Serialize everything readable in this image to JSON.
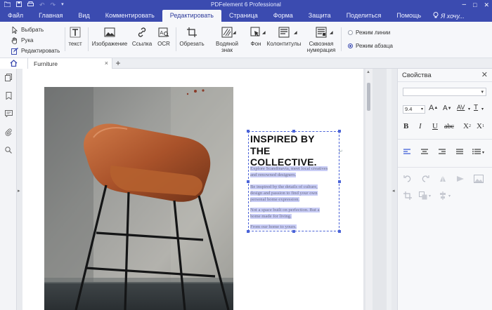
{
  "app": {
    "title": "PDFelement 6 Professional"
  },
  "window_controls": {
    "min": "–",
    "max": "□",
    "close": "✕"
  },
  "menu": {
    "items": [
      {
        "label": "Файл",
        "active": false
      },
      {
        "label": "Главная",
        "active": false
      },
      {
        "label": "Вид",
        "active": false
      },
      {
        "label": "Комментировать",
        "active": false
      },
      {
        "label": "Редактировать",
        "active": true
      },
      {
        "label": "Страница",
        "active": false
      },
      {
        "label": "Форма",
        "active": false
      },
      {
        "label": "Защита",
        "active": false
      },
      {
        "label": "Поделиться",
        "active": false
      },
      {
        "label": "Помощь",
        "active": false
      }
    ],
    "help_prompt": "Я хочу..."
  },
  "ribbon": {
    "select": "Выбрать",
    "hand": "Рука",
    "edit": "Редактировать",
    "text": "текст",
    "image": "Изображение",
    "link": "Ссылка",
    "ocr": "OCR",
    "crop": "Обрезать",
    "watermark": "Водяной знак",
    "background": "Фон",
    "headers": "Колонтитулы",
    "numbering_1": "Сквозная",
    "numbering_2": "нумерация",
    "mode_line": "Режим линии",
    "mode_paragraph": "Режим абзаца",
    "selected_mode": "paragraph"
  },
  "tabs": {
    "doc_tab": "Furniture",
    "add": "+",
    "close": "×"
  },
  "document": {
    "heading_1": "INSPIRED BY",
    "heading_2": "THE COLLECTIVE.",
    "para_1a": "Explore Scandinavia, meet local creatives",
    "para_1b": "and renowned designers.",
    "para_2a": "Be inspired by the details of culture,",
    "para_2b": "design and passion to find your own",
    "para_2c": "personal home expression.",
    "para_3a": "Not a space built on perfection. But a",
    "para_3b": "home made for living.",
    "para_4": "From our home to yours."
  },
  "properties": {
    "title": "Свойства",
    "close": "✕",
    "font_size": "9.4"
  },
  "colors": {
    "accent": "#3b4bb0",
    "selection_highlight": "#c9cdf6",
    "frame": "#4a63d8"
  }
}
